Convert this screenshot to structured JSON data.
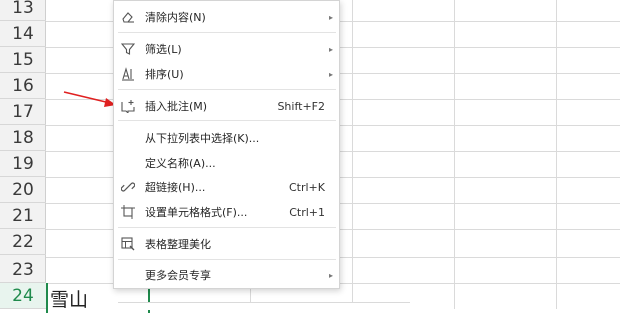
{
  "rows": [
    {
      "label": "13"
    },
    {
      "label": "14"
    },
    {
      "label": "15"
    },
    {
      "label": "16"
    },
    {
      "label": "17"
    },
    {
      "label": "18"
    },
    {
      "label": "19"
    },
    {
      "label": "20"
    },
    {
      "label": "21"
    },
    {
      "label": "22"
    },
    {
      "label": "23"
    },
    {
      "label": "24"
    }
  ],
  "active_cell_text": "雪山",
  "menu": {
    "clear": {
      "label": "清除内容(N)"
    },
    "filter": {
      "label": "筛选(L)"
    },
    "sort": {
      "label": "排序(U)"
    },
    "insert_comment": {
      "label": "插入批注(M)",
      "shortcut": "Shift+F2"
    },
    "pick_from_list": {
      "label": "从下拉列表中选择(K)..."
    },
    "define_name": {
      "label": "定义名称(A)..."
    },
    "hyperlink": {
      "label": "超链接(H)...",
      "shortcut": "Ctrl+K"
    },
    "format_cells": {
      "label": "设置单元格格式(F)...",
      "shortcut": "Ctrl+1"
    },
    "beautify": {
      "label": "表格整理美化"
    },
    "member": {
      "label": "更多会员专享"
    }
  },
  "colors": {
    "accent": "#1f8a4c",
    "arrow": "#e02020"
  },
  "icons": [
    "eraser-icon",
    "filter-icon",
    "sort-icon",
    "comment-icon",
    "link-icon",
    "format-cells-icon",
    "table-beautify-icon"
  ]
}
